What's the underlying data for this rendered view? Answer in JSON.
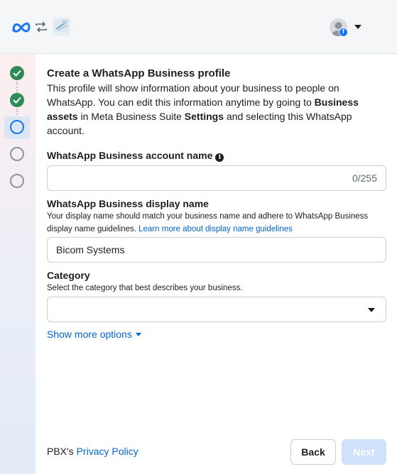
{
  "header": {
    "logo_icon": "meta-logo-icon",
    "swap_icon": "swap-arrows-icon",
    "app_icon": "app-thumbnail-icon",
    "avatar_icon": "user-avatar-icon",
    "avatar_badge": "f",
    "menu_icon": "caret-down-icon"
  },
  "steps": [
    {
      "state": "done"
    },
    {
      "state": "done"
    },
    {
      "state": "current"
    },
    {
      "state": "todo"
    },
    {
      "state": "todo"
    }
  ],
  "main": {
    "title": "Create a WhatsApp Business profile",
    "intro_part1": "This profile will show information about your business to people on WhatsApp. You can edit this information anytime by going to ",
    "intro_bold1": "Business assets",
    "intro_part2": " in Meta Business Suite ",
    "intro_bold2": "Settings",
    "intro_part3": " and selecting this WhatsApp account."
  },
  "account_name": {
    "label": "WhatsApp Business account name",
    "info_icon": "i",
    "value": "",
    "counter": "0/255"
  },
  "display_name": {
    "label": "WhatsApp Business display name",
    "help": "Your display name should match your business name and adhere to WhatsApp Business display name guidelines. ",
    "help_link": "Learn more about display name guidelines",
    "value": "Bicom Systems"
  },
  "category": {
    "label": "Category",
    "help": "Select the category that best describes your business.",
    "value": ""
  },
  "show_more": "Show more options",
  "footer": {
    "prefix": "PBX's ",
    "privacy_link": "Privacy Policy",
    "back_label": "Back",
    "next_label": "Next"
  },
  "colors": {
    "primary": "#1b74e4",
    "link": "#0064d1",
    "done_step": "#2f8a58",
    "next_disabled": "#cfe2fb"
  }
}
